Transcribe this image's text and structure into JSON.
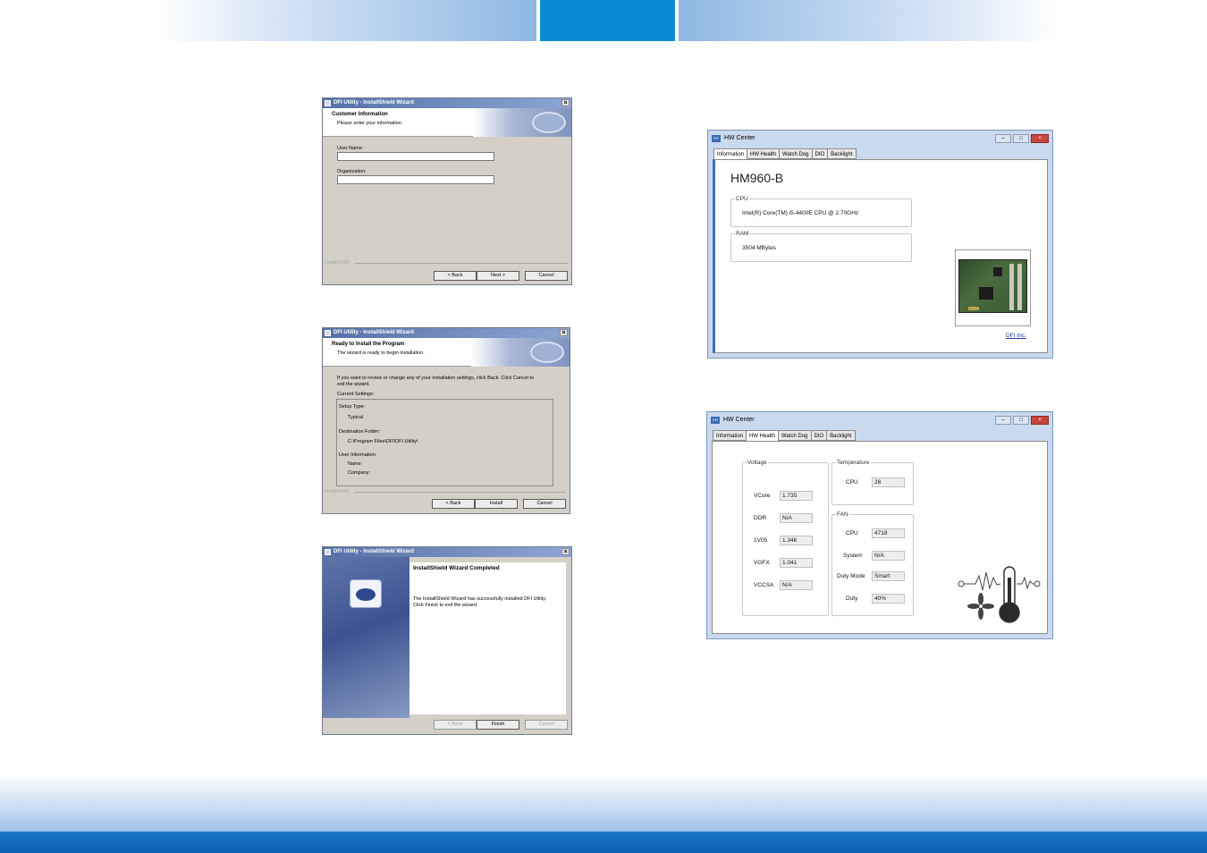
{
  "wizard1": {
    "title": "DFI Utility - InstallShield Wizard",
    "heading": "Customer Information",
    "subheading": "Please enter your information.",
    "user_name_label": "User Name:",
    "user_name_value": "",
    "organization_label": "Organization:",
    "organization_value": "",
    "brand": "InstallShield",
    "back": "< Back",
    "next": "Next >",
    "cancel": "Cancel"
  },
  "wizard2": {
    "title": "DFI Utility - InstallShield Wizard",
    "heading": "Ready to Install the Program",
    "subheading": "The wizard is ready to begin installation.",
    "info_line1": "If you want to review or change any of your installation settings, click Back. Click Cancel to",
    "info_line2": "exit the wizard.",
    "current_settings": "Current Settings:",
    "setup_type_label": "Setup Type:",
    "setup_type_value": "Typical",
    "dest_folder_label": "Destination Folder:",
    "dest_folder_value": "C:\\Program Files\\DFI\\DFI Utility\\",
    "user_info_label": "User Information:",
    "name_label": "Name:",
    "company_label": "Company:",
    "brand": "InstallShield",
    "back": "< Back",
    "install": "Install",
    "cancel": "Cancel"
  },
  "wizard3": {
    "title": "DFI Utility - InstallShield Wizard",
    "heading": "InstallShield Wizard Completed",
    "line1": "The InstallShield Wizard has successfully installed DFI Utility.",
    "line2": "Click Finish to exit the wizard.",
    "back": "< Back",
    "finish": "Finish",
    "cancel": "Cancel"
  },
  "hw_info": {
    "app_icon": "DFI",
    "title": "HW Center",
    "tabs": [
      "Information",
      "HW Health",
      "Watch Dog",
      "DIO",
      "Backlight"
    ],
    "model": "HM960-B",
    "cpu_label": "CPU",
    "cpu_value": "Intel(R) Core(TM) i5-4400E CPU @ 2.70GHz",
    "ram_label": "RAM",
    "ram_value": "3504 MBytes",
    "link": "DFI Inc."
  },
  "hw_health": {
    "app_icon": "DFI",
    "title": "HW Center",
    "tabs": [
      "Information",
      "HW Health",
      "Watch Dog",
      "DIO",
      "Backlight"
    ],
    "voltage_label": "Voltage",
    "voltage": [
      {
        "name": "VCore",
        "value": "1.735"
      },
      {
        "name": "DDR",
        "value": "N/A"
      },
      {
        "name": "1V05",
        "value": "1.346"
      },
      {
        "name": "VGFX",
        "value": "1.041"
      },
      {
        "name": "VCCSA",
        "value": "N/A"
      }
    ],
    "temperature_label": "Temperature",
    "temperature": [
      {
        "name": "CPU",
        "value": "28"
      }
    ],
    "fan_label": "FAN",
    "fan": [
      {
        "name": "CPU",
        "value": "4718"
      },
      {
        "name": "System",
        "value": "N/A"
      },
      {
        "name": "Duty Mode",
        "value": "Smart"
      },
      {
        "name": "Duty",
        "value": "40%"
      }
    ]
  }
}
